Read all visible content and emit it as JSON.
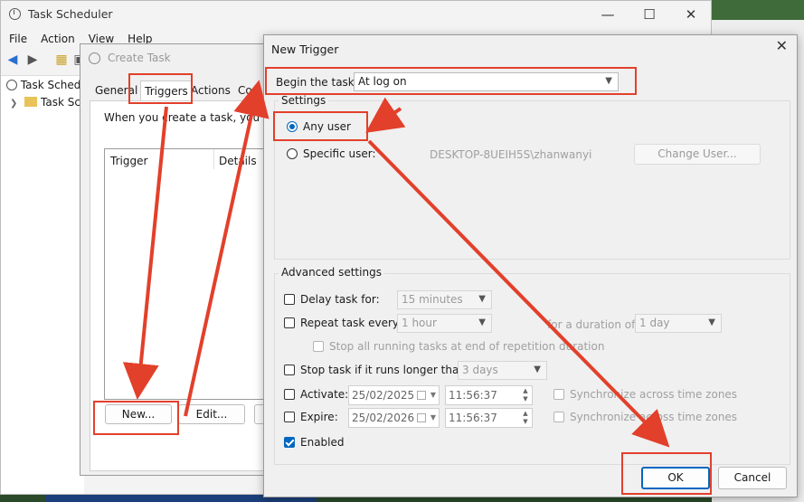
{
  "task_scheduler": {
    "title": "Task Scheduler",
    "menu": [
      "File",
      "Action",
      "View",
      "Help"
    ],
    "tree": [
      "Task Schedule",
      "Task Sche"
    ]
  },
  "create_task": {
    "title": "Create Task",
    "tabs": [
      "General",
      "Triggers",
      "Actions",
      "Co"
    ],
    "intro": "When you create a task, you can s",
    "columns": [
      "Trigger",
      "Details"
    ],
    "new_button": "New...",
    "edit_button": "Edit..."
  },
  "new_trigger": {
    "title": "New Trigger",
    "begin_label": "Begin the task:",
    "begin_value": "At log on",
    "settings_label": "Settings",
    "any_user": "Any user",
    "specific_user": "Specific user:",
    "user_name": "DESKTOP-8UEIH5S\\zhanwanyi",
    "change_user": "Change User...",
    "advanced_label": "Advanced settings",
    "delay_label": "Delay task for:",
    "delay_value": "15 minutes",
    "repeat_label": "Repeat task every:",
    "repeat_value": "1 hour",
    "duration_label": "for a duration of:",
    "duration_value": "1 day",
    "stop_all_label": "Stop all running tasks at end of repetition duration",
    "stop_longer_label": "Stop task if it runs longer than:",
    "stop_longer_value": "3 days",
    "activate_label": "Activate:",
    "activate_date": "25/02/2025",
    "activate_time": "11:56:37",
    "expire_label": "Expire:",
    "expire_date": "25/02/2026",
    "expire_time": "11:56:37",
    "sync_label": "Synchronize across time zones",
    "enabled_label": "Enabled",
    "ok": "OK",
    "cancel": "Cancel"
  },
  "annotation_color": "#e2402b",
  "accent_color": "#0067c0"
}
